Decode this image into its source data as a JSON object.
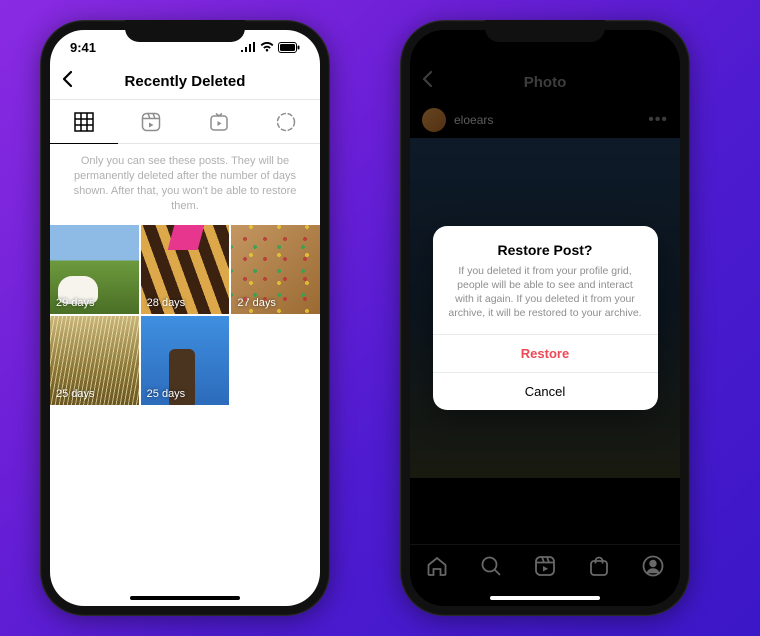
{
  "phone1": {
    "status_time": "9:41",
    "header_title": "Recently Deleted",
    "info_text": "Only you can see these posts. They will be permanently deleted after the number of days shown. After that, you won't be able to restore them.",
    "tabs": {
      "grid": "grid",
      "reels": "reels",
      "igtv": "igtv",
      "story": "story"
    },
    "items": [
      {
        "days_label": "29 days"
      },
      {
        "days_label": "28 days"
      },
      {
        "days_label": "27 days"
      },
      {
        "days_label": "25 days"
      },
      {
        "days_label": "25 days"
      }
    ]
  },
  "phone2": {
    "header_title": "Photo",
    "username": "eloears",
    "dialog": {
      "title": "Restore Post?",
      "body": "If you deleted it from your profile grid, people will be able to see and interact with it again. If you deleted it from your archive, it will be restored to your archive.",
      "restore_label": "Restore",
      "cancel_label": "Cancel"
    }
  }
}
